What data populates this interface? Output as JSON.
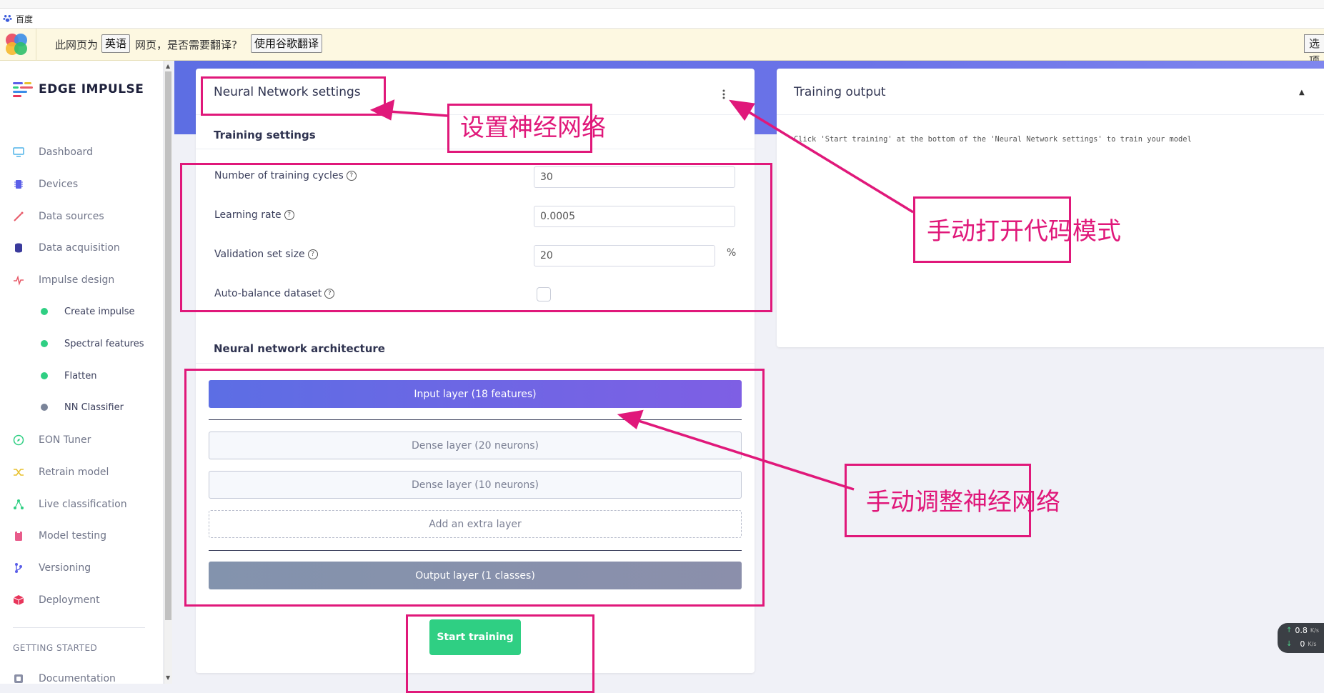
{
  "browser": {
    "tab_title": "百度",
    "translate_bar": {
      "prefix": "此网页为",
      "language": "英语",
      "suffix": "网页，是否需要翻译?",
      "translate_button": "使用谷歌翻译",
      "options_button": "选项"
    }
  },
  "sidebar": {
    "brand": "EDGE IMPULSE",
    "items": [
      {
        "label": "Dashboard",
        "icon": "monitor-icon",
        "color": "#4fb3e8"
      },
      {
        "label": "Devices",
        "icon": "chip-icon",
        "color": "#5b5fe8"
      },
      {
        "label": "Data sources",
        "icon": "wand-icon",
        "color": "#e85b6a"
      },
      {
        "label": "Data acquisition",
        "icon": "database-icon",
        "color": "#3a3a9c"
      },
      {
        "label": "Impulse design",
        "icon": "pulse-icon",
        "color": "#e85b6a"
      }
    ],
    "sub_items": [
      {
        "label": "Create impulse",
        "status_color": "#2fcf83"
      },
      {
        "label": "Spectral features",
        "status_color": "#2fcf83"
      },
      {
        "label": "Flatten",
        "status_color": "#2fcf83"
      },
      {
        "label": "NN Classifier",
        "status_color": "#7a8499"
      }
    ],
    "items2": [
      {
        "label": "EON Tuner",
        "icon": "compass-icon",
        "color": "#2fcf83"
      },
      {
        "label": "Retrain model",
        "icon": "shuffle-icon",
        "color": "#e8c12f"
      },
      {
        "label": "Live classification",
        "icon": "nodes-icon",
        "color": "#2fcf83"
      },
      {
        "label": "Model testing",
        "icon": "clipboard-icon",
        "color": "#e85b8a"
      },
      {
        "label": "Versioning",
        "icon": "branch-icon",
        "color": "#5b5fe8"
      },
      {
        "label": "Deployment",
        "icon": "box-icon",
        "color": "#e8365b"
      }
    ],
    "section_header": "GETTING STARTED",
    "documentation": "Documentation"
  },
  "nn_settings": {
    "title": "Neural Network settings",
    "training_section": "Training settings",
    "fields": {
      "cycles_label": "Number of training cycles",
      "cycles_value": "30",
      "lr_label": "Learning rate",
      "lr_value": "0.0005",
      "val_label": "Validation set size",
      "val_value": "20",
      "val_unit": "%",
      "balance_label": "Auto-balance dataset"
    },
    "architecture_section": "Neural network architecture",
    "layers": {
      "input": "Input layer (18 features)",
      "dense1": "Dense layer (20 neurons)",
      "dense2": "Dense layer (10 neurons)",
      "add": "Add an extra layer",
      "output": "Output layer (1 classes)"
    },
    "start_button": "Start training"
  },
  "training_output": {
    "title": "Training output",
    "message": "Click 'Start training' at the bottom of the 'Neural Network settings' to train your model"
  },
  "annotations": {
    "nn_settings": "设置神经网络",
    "code_mode": "手动打开代码模式",
    "adjust_network": "手动调整神经网络",
    "color": "#e0187a"
  },
  "net_speed": {
    "up": "0.8",
    "up_unit": "K/s",
    "down": "0",
    "down_unit": "K/s"
  }
}
